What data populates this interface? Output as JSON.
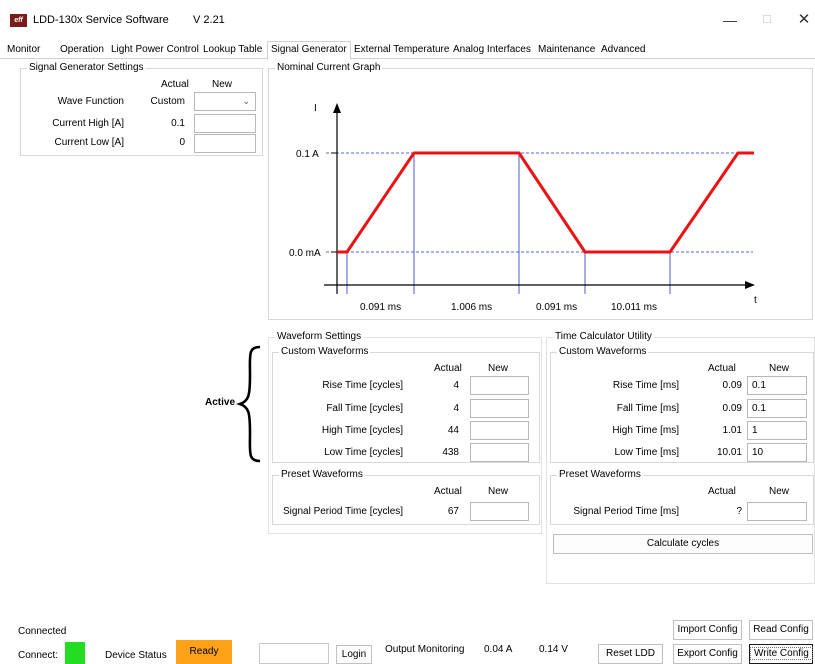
{
  "window": {
    "title": "LDD-130x Service Software",
    "version": "V 2.21",
    "icon_text": "eff",
    "icons": {
      "minimize": "minimize-icon",
      "maximize": "maximize-icon",
      "close": "close-icon"
    }
  },
  "tabs": [
    {
      "label": "Monitor"
    },
    {
      "label": "Operation"
    },
    {
      "label": "Light Power Control"
    },
    {
      "label": "Lookup Table"
    },
    {
      "label": "Signal Generator",
      "active": true
    },
    {
      "label": "External Temperature"
    },
    {
      "label": "Analog Interfaces"
    },
    {
      "label": "Maintenance"
    },
    {
      "label": "Advanced"
    }
  ],
  "signal_generator_settings": {
    "title": "Signal Generator Settings",
    "col_actual": "Actual",
    "col_new": "New",
    "wave_function": {
      "label": "Wave Function",
      "actual": "Custom",
      "new": ""
    },
    "current_high": {
      "label": "Current High [A]",
      "actual": "0.1",
      "new": ""
    },
    "current_low": {
      "label": "Current Low [A]",
      "actual": "0",
      "new": ""
    }
  },
  "graph": {
    "title": "Nominal Current Graph",
    "y_axis_label": "I",
    "x_axis_label": "t",
    "high_label": "0.1 A",
    "low_label": "0.0 mA",
    "segments": [
      {
        "label": "0.091 ms",
        "kind": "rise"
      },
      {
        "label": "1.006 ms",
        "kind": "high"
      },
      {
        "label": "0.091 ms",
        "kind": "fall"
      },
      {
        "label": "10.011 ms",
        "kind": "low"
      }
    ],
    "colors": {
      "signal": "#ee1111",
      "guide": "#2233cc",
      "axis": "#000000"
    }
  },
  "active_label": "Active",
  "waveform_settings": {
    "title": "Waveform Settings",
    "custom_title": "Custom Waveforms",
    "col_actual": "Actual",
    "col_new": "New",
    "rows": [
      {
        "label": "Rise Time [cycles]",
        "actual": "4",
        "new": ""
      },
      {
        "label": "Fall Time [cycles]",
        "actual": "4",
        "new": ""
      },
      {
        "label": "High Time [cycles]",
        "actual": "44",
        "new": ""
      },
      {
        "label": "Low Time [cycles]",
        "actual": "438",
        "new": ""
      }
    ],
    "preset_title": "Preset Waveforms",
    "preset": {
      "label": "Signal Period Time [cycles]",
      "actual": "67",
      "new": ""
    }
  },
  "time_calculator": {
    "title": "Time Calculator Utility",
    "custom_title": "Custom Waveforms",
    "col_actual": "Actual",
    "col_new": "New",
    "rows": [
      {
        "label": "Rise Time [ms]",
        "actual": "0.09",
        "new": "0.1"
      },
      {
        "label": "Fall Time [ms]",
        "actual": "0.09",
        "new": "0.1"
      },
      {
        "label": "High Time [ms]",
        "actual": "1.01",
        "new": "1"
      },
      {
        "label": "Low Time [ms]",
        "actual": "10.01",
        "new": "10"
      }
    ],
    "preset_title": "Preset Waveforms",
    "preset": {
      "label": "Signal Period Time [ms]",
      "actual": "?",
      "new": ""
    },
    "calculate_label": "Calculate cycles"
  },
  "footer": {
    "connection_text": "Connected",
    "connect_label": "Connect:",
    "connect_color": "#22dd22",
    "device_status_label": "Device Status",
    "device_status_value": "Ready",
    "device_status_color": "#ffa218",
    "login_label": "Login",
    "output_monitoring_label": "Output Monitoring",
    "output_current": "0.04 A",
    "output_voltage": "0.14 V",
    "reset_ldd_label": "Reset LDD",
    "import_config_label": "Import Config",
    "export_config_label": "Export Config",
    "read_config_label": "Read Config",
    "write_config_label": "Write Config"
  }
}
